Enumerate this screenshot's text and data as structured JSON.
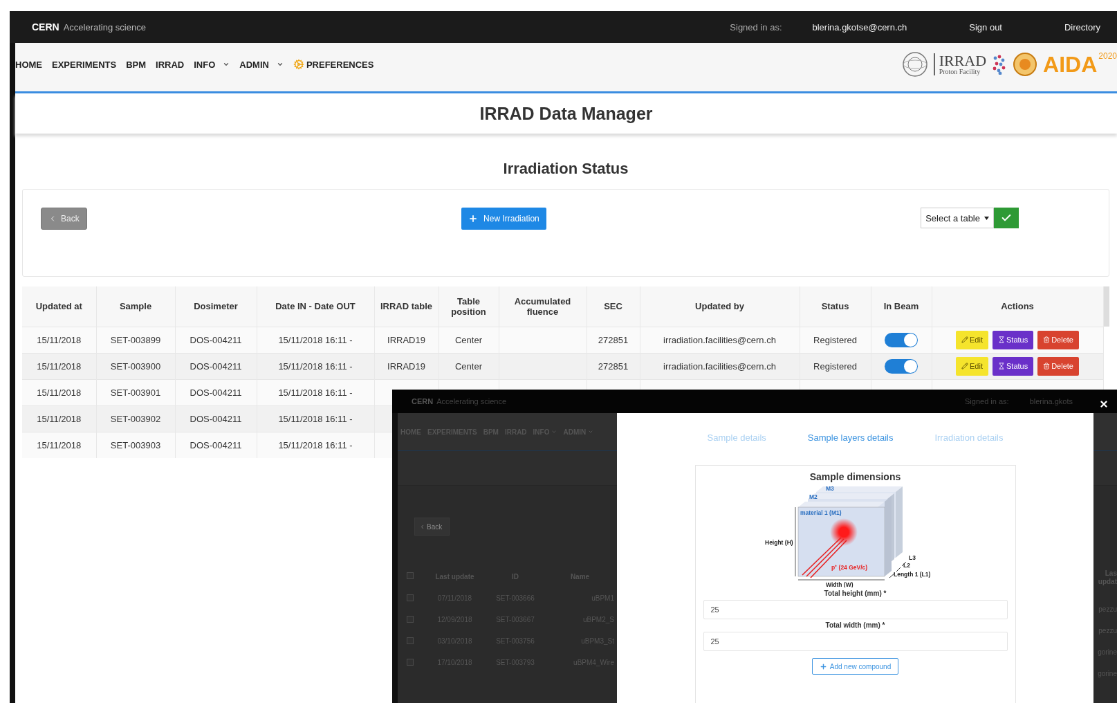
{
  "topbar": {
    "brand": "CERN",
    "tagline": "Accelerating science",
    "signed_in_label": "Signed in as:",
    "user": "blerina.gkotse@cern.ch",
    "links": [
      "Sign out",
      "Directory"
    ]
  },
  "nav": {
    "items": [
      {
        "label": "HOME",
        "dropdown": false,
        "kind": "plain"
      },
      {
        "label": "EXPERIMENTS",
        "dropdown": false,
        "kind": "plain"
      },
      {
        "label": "BPM",
        "dropdown": false,
        "kind": "plain"
      },
      {
        "label": "IRRAD",
        "dropdown": false,
        "kind": "plain"
      },
      {
        "label": "INFO",
        "dropdown": true,
        "kind": "plain"
      },
      {
        "label": "ADMIN",
        "dropdown": true,
        "kind": "plain"
      },
      {
        "label": "PREFERENCES",
        "dropdown": false,
        "kind": "gear"
      }
    ],
    "logos": {
      "irrad": "IRRAD",
      "irrad_sub": "Proton Facility",
      "aida": "AIDA",
      "aida_year": "2020"
    }
  },
  "page_title": "IRRAD Data Manager",
  "section_title": "Irradiation Status",
  "controls": {
    "back": "Back",
    "new_irradiation": "New Irradiation",
    "table_select": "Select a table"
  },
  "table": {
    "columns": [
      "Updated at",
      "Sample",
      "Dosimeter",
      "Date IN - Date OUT",
      "IRRAD table",
      "Table position",
      "Accumulated fluence",
      "SEC",
      "Updated by",
      "Status",
      "In Beam",
      "Actions"
    ],
    "rows": [
      {
        "cells": [
          "15/11/2018",
          "SET-003899",
          "DOS-004211",
          "15/11/2018 16:11 -",
          "IRRAD19",
          "Center",
          "",
          "272851",
          "irradiation.facilities@cern.ch",
          "Registered"
        ],
        "in_beam": true,
        "actions": [
          {
            "label": "Edit",
            "kind": "edit"
          },
          {
            "label": "Status",
            "kind": "status"
          },
          {
            "label": "Delete",
            "kind": "delete"
          }
        ]
      },
      {
        "cells": [
          "15/11/2018",
          "SET-003900",
          "DOS-004211",
          "15/11/2018 16:11 -",
          "IRRAD19",
          "Center",
          "",
          "272851",
          "irradiation.facilities@cern.ch",
          "Registered"
        ],
        "in_beam": true,
        "actions": [
          {
            "label": "Edit",
            "kind": "edit"
          },
          {
            "label": "Status",
            "kind": "status"
          },
          {
            "label": "Delete",
            "kind": "delete"
          }
        ]
      },
      {
        "cells": [
          "15/11/2018",
          "SET-003901",
          "DOS-004211",
          "15/11/2018 16:11 -"
        ]
      },
      {
        "cells": [
          "15/11/2018",
          "SET-003902",
          "DOS-004211",
          "15/11/2018 16:11 -"
        ]
      },
      {
        "cells": [
          "15/11/2018",
          "SET-003903",
          "DOS-004211",
          "15/11/2018 16:11 -"
        ]
      }
    ]
  },
  "overlay_window": {
    "topbar": {
      "brand": "CERN",
      "tagline": "Accelerating science",
      "signed_in_label": "Signed in as:",
      "user": "blerina.gkots"
    },
    "nav": [
      {
        "label": "HOME",
        "dropdown": false
      },
      {
        "label": "EXPERIMENTS",
        "dropdown": false
      },
      {
        "label": "BPM",
        "dropdown": false
      },
      {
        "label": "IRRAD",
        "dropdown": false
      },
      {
        "label": "INFO",
        "dropdown": true
      },
      {
        "label": "ADMIN",
        "dropdown": true
      }
    ],
    "back": "Back",
    "table": {
      "select_all_checked": false,
      "columns": [
        "Last update",
        "ID",
        "Name"
      ],
      "rows": [
        {
          "checked": false,
          "cells": [
            "07/11/2018",
            "SET-003666",
            "uBPM1"
          ]
        },
        {
          "checked": false,
          "cells": [
            "12/09/2018",
            "SET-003667",
            "uBPM2_S"
          ]
        },
        {
          "checked": false,
          "cells": [
            "03/10/2018",
            "SET-003756",
            "uBPM3_St"
          ]
        },
        {
          "checked": false,
          "cells": [
            "17/10/2018",
            "SET-003793",
            "uBPM4_Wire"
          ]
        }
      ]
    },
    "right_column": {
      "header": "Las updat",
      "cells": [
        "pezzu",
        "pezzu",
        "gorine",
        "gorine"
      ]
    },
    "modal": {
      "tabs": [
        {
          "label": "Sample details",
          "selected": false
        },
        {
          "label": "Sample layers details",
          "selected": true
        },
        {
          "label": "Irradiation details",
          "selected": false
        }
      ],
      "card_title": "Sample dimensions",
      "diagram": {
        "m3": "M3",
        "m2": "M2",
        "m1": "material 1 (M1)",
        "height": "Height (H)",
        "beam": "p⁺ (24 GeV/c)",
        "l3": "L3",
        "l2": "L2",
        "l1": "Length 1 (L1)",
        "width": "Width (W)"
      },
      "fields": [
        {
          "label": "Total height (mm) *",
          "value": "25"
        },
        {
          "label": "Total width (mm) *",
          "value": "25"
        }
      ],
      "add_button": "Add new compound"
    }
  }
}
